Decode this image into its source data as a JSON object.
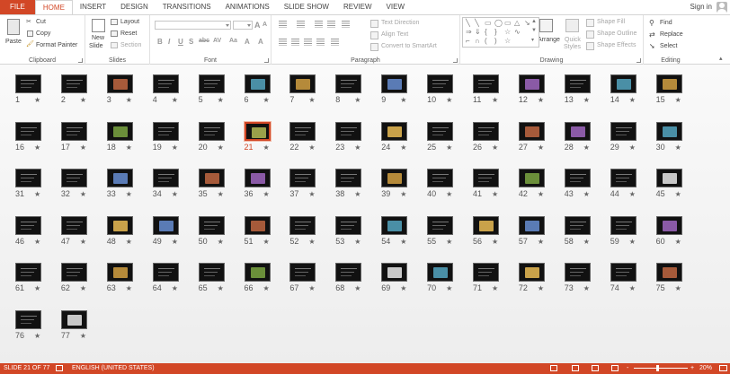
{
  "tabs": [
    "FILE",
    "HOME",
    "INSERT",
    "DESIGN",
    "TRANSITIONS",
    "ANIMATIONS",
    "SLIDE SHOW",
    "REVIEW",
    "VIEW"
  ],
  "active_tab": "HOME",
  "account": {
    "sign_in": "Sign in"
  },
  "ribbon": {
    "clipboard": {
      "label": "Clipboard",
      "paste": "Paste",
      "cut": "Cut",
      "copy": "Copy",
      "format_painter": "Format Painter"
    },
    "slides": {
      "label": "Slides",
      "new_slide": "New",
      "new_slide_2": "Slide",
      "layout": "Layout",
      "reset": "Reset",
      "section": "Section"
    },
    "font": {
      "label": "Font"
    },
    "paragraph": {
      "label": "Paragraph",
      "text_direction": "Text Direction",
      "align_text": "Align Text",
      "convert_smartart": "Convert to SmartArt"
    },
    "drawing": {
      "label": "Drawing",
      "arrange": "Arrange",
      "quick_styles": "Quick",
      "quick_styles_2": "Styles",
      "shape_fill": "Shape Fill",
      "shape_outline": "Shape Outline",
      "shape_effects": "Shape Effects"
    },
    "editing": {
      "label": "Editing",
      "find": "Find",
      "replace": "Replace",
      "select": "Select"
    }
  },
  "slides": {
    "count": 77,
    "selected": 21,
    "per_row": 15,
    "star": "★"
  },
  "status": {
    "slide_info": "SLIDE 21 OF 77",
    "language": "ENGLISH (UNITED STATES)",
    "zoom": "20%",
    "zoom_minus": "-",
    "zoom_plus": "+"
  },
  "colors": {
    "accent": "#d24726",
    "selection": "#d24726"
  }
}
